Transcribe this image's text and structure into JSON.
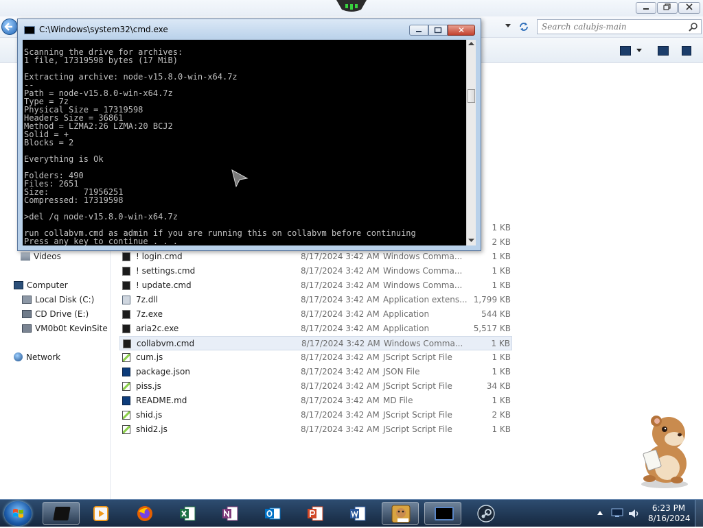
{
  "explorer": {
    "search_placeholder": "Search calubjs-main",
    "nav": {
      "videos": "Videos",
      "computer": "Computer",
      "local_disk": "Local Disk (C:)",
      "cd_drive": "CD Drive (E:)",
      "network_drive": "VM0b0t KevinSite",
      "network": "Network"
    },
    "partial_sizes": [
      "1 KB",
      "2 KB"
    ],
    "files": [
      {
        "name": "! login.cmd",
        "date": "8/17/2024 3:42 AM",
        "type": "Windows Comma...",
        "size": "1 KB",
        "icon": "cmd-file-icon"
      },
      {
        "name": "! settings.cmd",
        "date": "8/17/2024 3:42 AM",
        "type": "Windows Comma...",
        "size": "1 KB",
        "icon": "cmd-file-icon"
      },
      {
        "name": "! update.cmd",
        "date": "8/17/2024 3:42 AM",
        "type": "Windows Comma...",
        "size": "1 KB",
        "icon": "cmd-file-icon"
      },
      {
        "name": "7z.dll",
        "date": "8/17/2024 3:42 AM",
        "type": "Application extens...",
        "size": "1,799 KB",
        "icon": "dll-file-icon"
      },
      {
        "name": "7z.exe",
        "date": "8/17/2024 3:42 AM",
        "type": "Application",
        "size": "544 KB",
        "icon": "exe-file-icon"
      },
      {
        "name": "aria2c.exe",
        "date": "8/17/2024 3:42 AM",
        "type": "Application",
        "size": "5,517 KB",
        "icon": "exe-file-icon"
      },
      {
        "name": "collabvm.cmd",
        "date": "8/17/2024 3:42 AM",
        "type": "Windows Comma...",
        "size": "1 KB",
        "icon": "cmd-file-icon"
      },
      {
        "name": "cum.js",
        "date": "8/17/2024 3:42 AM",
        "type": "JScript Script File",
        "size": "1 KB",
        "icon": "js-file-icon"
      },
      {
        "name": "package.json",
        "date": "8/17/2024 3:42 AM",
        "type": "JSON File",
        "size": "1 KB",
        "icon": "json-file-icon"
      },
      {
        "name": "piss.js",
        "date": "8/17/2024 3:42 AM",
        "type": "JScript Script File",
        "size": "34 KB",
        "icon": "js-file-icon"
      },
      {
        "name": "README.md",
        "date": "8/17/2024 3:42 AM",
        "type": "MD File",
        "size": "1 KB",
        "icon": "md-file-icon"
      },
      {
        "name": "shid.js",
        "date": "8/17/2024 3:42 AM",
        "type": "JScript Script File",
        "size": "2 KB",
        "icon": "js-file-icon"
      },
      {
        "name": "shid2.js",
        "date": "8/17/2024 3:42 AM",
        "type": "JScript Script File",
        "size": "1 KB",
        "icon": "js-file-icon"
      }
    ]
  },
  "cmd": {
    "title": "C:\\Windows\\system32\\cmd.exe",
    "close_glyph": "✕",
    "lines": [
      "Scanning the drive for archives:",
      "1 file, 17319598 bytes (17 MiB)",
      "",
      "Extracting archive: node-v15.8.0-win-x64.7z",
      "--",
      "Path = node-v15.8.0-win-x64.7z",
      "Type = 7z",
      "Physical Size = 17319598",
      "Headers Size = 36861",
      "Method = LZMA2:26 LZMA:20 BCJ2",
      "Solid = +",
      "Blocks = 2",
      "",
      "Everything is Ok",
      "",
      "Folders: 490",
      "Files: 2651",
      "Size:       71956251",
      "Compressed: 17319598",
      "",
      ">del /q node-v15.8.0-win-x64.7z",
      "",
      "run collabvm.cmd as admin if you are running this on collabvm before continuing",
      "Press any key to continue . . . _"
    ]
  },
  "taskbar": {
    "clock_time": "6:23 PM",
    "clock_date": "8/16/2024",
    "apps": [
      {
        "name": "Windows Media Center",
        "icon": "media-center-icon"
      },
      {
        "name": "Windows Media Player",
        "icon": "media-player-icon"
      },
      {
        "name": "Firefox",
        "icon": "firefox-icon"
      },
      {
        "name": "Excel",
        "icon": "excel-icon"
      },
      {
        "name": "OneNote",
        "icon": "onenote-icon"
      },
      {
        "name": "Outlook",
        "icon": "outlook-icon"
      },
      {
        "name": "PowerPoint",
        "icon": "powerpoint-icon"
      },
      {
        "name": "Word",
        "icon": "word-icon"
      },
      {
        "name": "Hamster Box",
        "icon": "hamster-box-icon"
      },
      {
        "name": "Command Prompt",
        "icon": "cmd-icon"
      },
      {
        "name": "Steam",
        "icon": "steam-icon"
      }
    ]
  },
  "colors": {
    "taskbar": "#1e3654",
    "cmd_background": "#000000",
    "cmd_text": "#c0c0c0",
    "selected_row": "#e8eef7"
  }
}
